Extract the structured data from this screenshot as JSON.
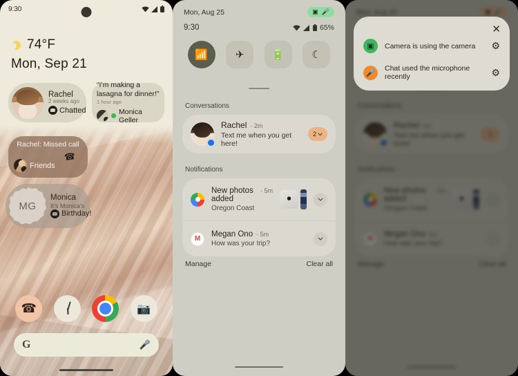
{
  "home": {
    "statusbar": {
      "time": "9:30",
      "wifi_icon": "wifi-icon",
      "signal_icon": "signal-icon",
      "battery_icon": "battery-icon"
    },
    "weather": {
      "icon": "partly-sunny-icon",
      "temperature": "74°F",
      "date": "Mon, Sep 21"
    },
    "widgets": {
      "rachel": {
        "name": "Rachel",
        "timestamp": "2 weeks ago",
        "status": "Chatted",
        "badge_icon": "message-bubble-icon"
      },
      "monica_quote": {
        "quote": "“I’m making a lasagna for dinner!”",
        "timestamp": "1 hour ago",
        "name": "Monica Geller",
        "presence": "online"
      },
      "missed_call": {
        "title": "Rachel: Missed call",
        "icon": "missed-call-icon",
        "group": "Friends"
      },
      "monica_birthday": {
        "initials": "MG",
        "name": "Monica",
        "line1": "It’s Monica’s",
        "line2": "Birthday!",
        "badge_icon": "message-bubble-icon"
      }
    },
    "dock": [
      {
        "name": "phone-app",
        "glyph": "☎"
      },
      {
        "name": "clock-app",
        "glyph": ""
      },
      {
        "name": "chrome-app",
        "glyph": ""
      },
      {
        "name": "camera-app",
        "glyph": "📷"
      }
    ],
    "search": {
      "logo": "G",
      "placeholder": "",
      "mic_icon": "microphone-icon"
    }
  },
  "shade": {
    "date": "Mon, Aug 25",
    "time": "9:30",
    "battery_percent": "65%",
    "privacy_pill": {
      "camera_icon": "camera-icon",
      "mic_icon": "microphone-icon"
    },
    "tiles": [
      {
        "name": "wifi-tile",
        "glyph": "📶",
        "active": true
      },
      {
        "name": "airplane-mode-tile",
        "glyph": "✈",
        "active": false
      },
      {
        "name": "battery-saver-tile",
        "glyph": "🔋",
        "active": false
      },
      {
        "name": "do-not-disturb-tile",
        "glyph": "☾",
        "active": false
      }
    ],
    "sections": {
      "conversations": "Conversations",
      "notifications": "Notifications"
    },
    "conversation": {
      "name": "Rachel",
      "time": "2m",
      "message": "Text me when you get here!",
      "count": "2",
      "chevron": "⌄"
    },
    "notifications": [
      {
        "title": "New photos added",
        "time": "5m",
        "subtitle": "Oregon Coast",
        "app": "google-photos",
        "has_thumbs": true
      },
      {
        "title": "Megan Ono",
        "time": "5m",
        "subtitle": "How was your trip?",
        "app": "gmail",
        "app_letter": "M",
        "has_thumbs": false
      }
    ],
    "footer": {
      "manage": "Manage",
      "clear_all": "Clear all"
    }
  },
  "dialog": {
    "close_icon": "close-icon",
    "items": [
      {
        "label": "Camera is using the camera",
        "icon": "camera-icon",
        "color": "#43b55e",
        "gear": "gear-icon"
      },
      {
        "label": "Chat used the microphone recently",
        "icon": "microphone-icon",
        "color": "#f08a2e",
        "gear": "gear-icon"
      }
    ]
  },
  "colors": {
    "home_bg": "#efebdc",
    "shade_bg": "#cfcec4",
    "card_bg": "#dbd9cf",
    "accent_green": "#8fdba2",
    "accent_peach": "#eab487",
    "tile_active": "#5b5d4d"
  }
}
